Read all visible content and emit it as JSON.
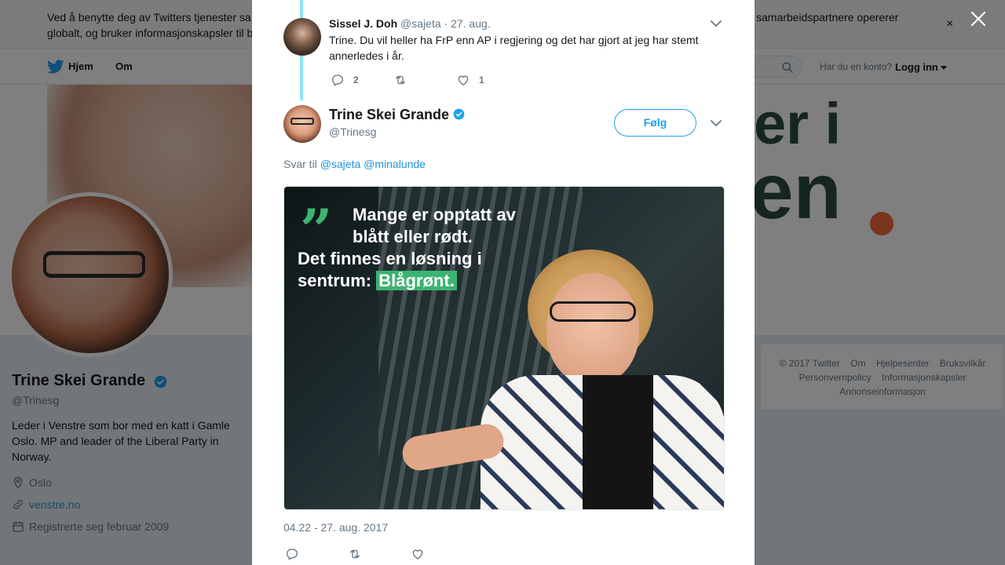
{
  "cookie": {
    "text_left": "Ved å benytte deg av Twitters tjenester sa",
    "text_right": "samarbeidspartnere opererer",
    "text_line2": "globalt, og bruker informasjonskapsler til b",
    "close_label": "×"
  },
  "nav": {
    "home": "Hjem",
    "about": "Om",
    "account_question": "Har du en konto?",
    "login": "Logg inn"
  },
  "banner": {
    "slogan_line1": "er i",
    "slogan_line2": "en"
  },
  "profile": {
    "name": "Trine Skei Grande",
    "handle": "@Trinesg",
    "bio": "Leder i Venstre som bor med en katt i Gamle Oslo. MP and leader of the Liberal Party in Norway.",
    "location": "Oslo",
    "website": "venstre.no",
    "joined": "Registrerte seg februar 2009"
  },
  "footer": {
    "row1": [
      "© 2017 Twitter",
      "Om",
      "Hjelpesenter",
      "Bruksvilkår"
    ],
    "row2": [
      "Personvernpolicy",
      "Informasjonskapsler"
    ],
    "row3": [
      "Annonseinformasjon"
    ]
  },
  "modal": {
    "reply_tweet": {
      "name": "Sissel J. Doh",
      "handle": "@sajeta",
      "time": "· 27. aug.",
      "text": "Trine. Du vil heller ha FrP enn AP i regjering og det har gjort at jeg har stemt annerledes i år.",
      "reply_count": "2",
      "retweet_count": "",
      "like_count": "1"
    },
    "main_tweet": {
      "name": "Trine Skei Grande",
      "handle": "@Trinesg",
      "follow_label": "Følg",
      "reply_to_prefix": "Svar til",
      "mention1": "@sajeta",
      "mention2": "@minalunde",
      "image_quote_line1": "Mange er opptatt av",
      "image_quote_line2": "blått eller rødt.",
      "image_quote_line3": "Det finnes en løsning i",
      "image_quote_line4": "sentrum:",
      "image_quote_highlight": "Blågrønt.",
      "timestamp": "04.22 - 27. aug. 2017"
    }
  },
  "colors": {
    "accent": "#1da1f2",
    "link": "#1b95e0",
    "muted": "#657786",
    "thread_line": "#8ee4f5",
    "slogan": "#2b4a44",
    "slogan_dot": "#f16a32",
    "highlight_green": "#3cb371"
  },
  "icons": {
    "bird": "twitter-bird-icon",
    "search": "search-icon",
    "close": "close-icon",
    "verified": "verified-badge-icon",
    "location": "location-pin-icon",
    "link": "link-icon",
    "calendar": "calendar-icon",
    "reply": "reply-icon",
    "retweet": "retweet-icon",
    "like": "heart-icon",
    "caret": "chevron-down-icon"
  }
}
